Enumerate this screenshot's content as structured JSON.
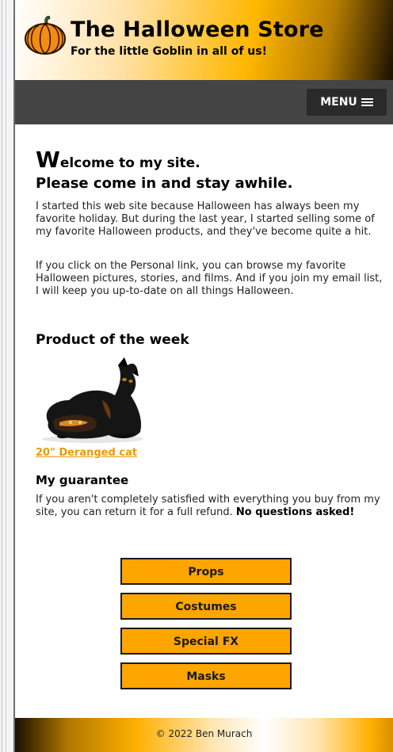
{
  "header": {
    "title": "The Halloween Store",
    "tagline": "For the little Goblin in all of us!",
    "logo_icon": "pumpkin-icon"
  },
  "nav": {
    "menu_label": "MENU",
    "menu_icon": "hamburger-icon"
  },
  "main": {
    "welcome_first_letter": "W",
    "welcome_rest": "elcome to my site.",
    "subheading": "Please come in and stay awhile.",
    "paragraph1": "I started this web site because Halloween has always been my favorite holiday. But during the last year, I started selling some of my favorite Halloween products, and they've become quite a hit.",
    "paragraph2": "If you click on the Personal link, you can browse my favorite Halloween pictures, stories, and films. And if you join my email list, I will keep you up-to-date on all things Halloween.",
    "product_heading": "Product of the week",
    "product_link": "20\" Deranged cat",
    "guarantee_heading": "My guarantee",
    "guarantee_text": "If you aren't completely satisfied with everything you buy from my site, you can return it for a full refund.",
    "guarantee_bold": "No questions asked!"
  },
  "category_buttons": [
    "Props",
    "Costumes",
    "Special FX",
    "Masks"
  ],
  "footer": {
    "copyright": "© 2022 Ben Murach"
  },
  "colors": {
    "accent": "#ffa500",
    "nav_bar": "#444444",
    "link": "#e99b00"
  }
}
